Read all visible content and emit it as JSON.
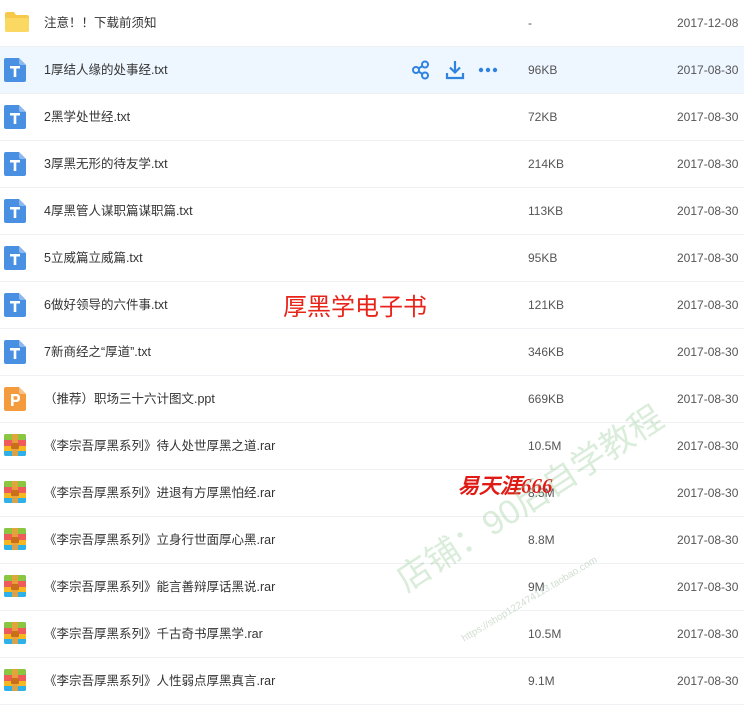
{
  "files": [
    {
      "name": "注意！！下载前须知",
      "size": "-",
      "date": "2017-12-08",
      "type": "folder"
    },
    {
      "name": "1厚结人缘的处事经.txt",
      "size": "96KB",
      "date": "2017-08-30",
      "type": "txt",
      "selected": true
    },
    {
      "name": "2黑学处世经.txt",
      "size": "72KB",
      "date": "2017-08-30",
      "type": "txt"
    },
    {
      "name": "3厚黑无形的待友学.txt",
      "size": "214KB",
      "date": "2017-08-30",
      "type": "txt"
    },
    {
      "name": "4厚黑管人谋职篇谋职篇.txt",
      "size": "113KB",
      "date": "2017-08-30",
      "type": "txt"
    },
    {
      "name": "5立威篇立威篇.txt",
      "size": "95KB",
      "date": "2017-08-30",
      "type": "txt"
    },
    {
      "name": "6做好领导的六件事.txt",
      "size": "121KB",
      "date": "2017-08-30",
      "type": "txt"
    },
    {
      "name": "7新商经之“厚道”.txt",
      "size": "346KB",
      "date": "2017-08-30",
      "type": "txt"
    },
    {
      "name": "（推荐）职场三十六计图文.ppt",
      "size": "669KB",
      "date": "2017-08-30",
      "type": "ppt"
    },
    {
      "name": "《李宗吾厚黑系列》待人处世厚黑之道.rar",
      "size": "10.5M",
      "date": "2017-08-30",
      "type": "rar"
    },
    {
      "name": "《李宗吾厚黑系列》进退有方厚黑怕经.rar",
      "size": "8.5M",
      "date": "2017-08-30",
      "type": "rar"
    },
    {
      "name": "《李宗吾厚黑系列》立身行世面厚心黑.rar",
      "size": "8.8M",
      "date": "2017-08-30",
      "type": "rar"
    },
    {
      "name": "《李宗吾厚黑系列》能言善辩厚话黑说.rar",
      "size": "9M",
      "date": "2017-08-30",
      "type": "rar"
    },
    {
      "name": "《李宗吾厚黑系列》千古奇书厚黑学.rar",
      "size": "10.5M",
      "date": "2017-08-30",
      "type": "rar"
    },
    {
      "name": "《李宗吾厚黑系列》人性弱点厚黑真言.rar",
      "size": "9.1M",
      "date": "2017-08-30",
      "type": "rar"
    }
  ],
  "row_actions": {
    "share_icon": "share-icon",
    "download_icon": "download-icon",
    "more_icon": "more-icon"
  },
  "watermarks": {
    "title": "厚黑学电子书",
    "author": "易天涯666",
    "shop": "店铺：90后自学教程",
    "url": "https://shop122474113.taobao.com"
  },
  "colors": {
    "folder": "#f7c94b",
    "txt": "#4a90e2",
    "ppt": "#f39b3d",
    "selected_row": "#eef6ff",
    "action_icon": "#2f82e0",
    "watermark_red": "#e8241a"
  }
}
